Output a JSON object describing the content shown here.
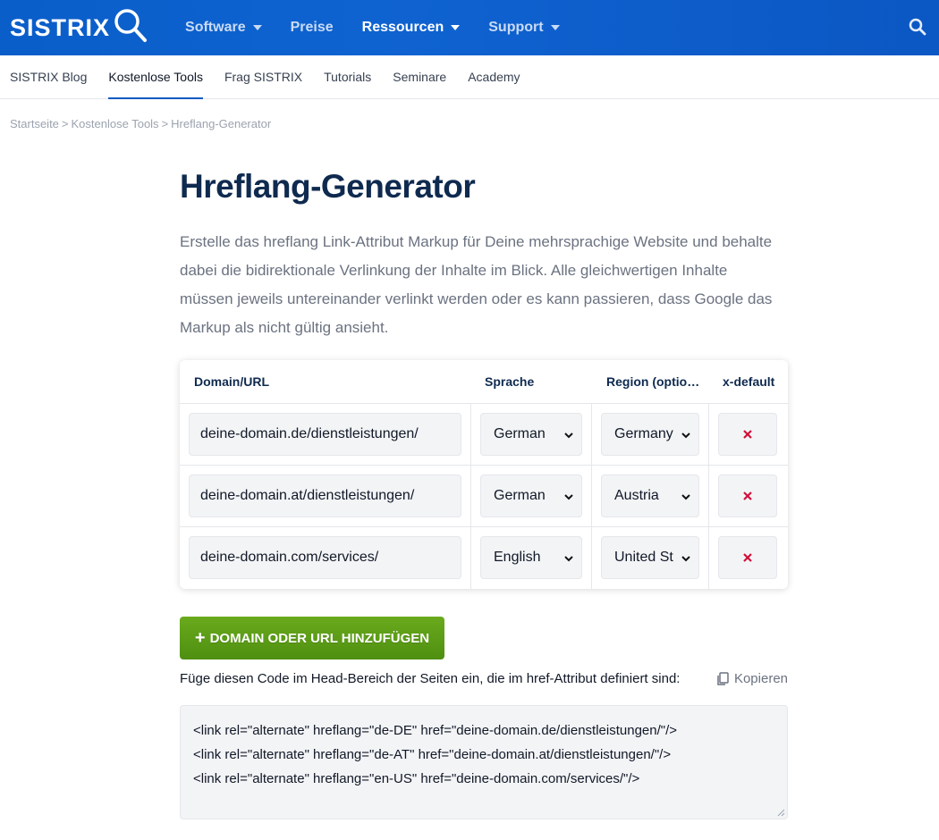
{
  "header": {
    "logo_text": "SISTRIX",
    "nav": [
      {
        "label": "Software",
        "has_caret": true,
        "active": false
      },
      {
        "label": "Preise",
        "has_caret": false,
        "active": false
      },
      {
        "label": "Ressourcen",
        "has_caret": true,
        "active": true
      },
      {
        "label": "Support",
        "has_caret": true,
        "active": false
      }
    ],
    "brand_color": "#0a5ec9"
  },
  "subnav": [
    {
      "label": "SISTRIX Blog",
      "active": false
    },
    {
      "label": "Kostenlose Tools",
      "active": true
    },
    {
      "label": "Frag SISTRIX",
      "active": false
    },
    {
      "label": "Tutorials",
      "active": false
    },
    {
      "label": "Seminare",
      "active": false
    },
    {
      "label": "Academy",
      "active": false
    }
  ],
  "breadcrumb": {
    "items": [
      "Startseite",
      "Kostenlose Tools",
      "Hreflang-Generator"
    ],
    "separator": ">"
  },
  "main": {
    "title": "Hreflang-Generator",
    "intro": "Erstelle das hreflang Link-Attribut Markup für Deine mehrsprachige Website und behalte dabei die bidirektionale Verlinkung der Inhalte im Blick. Alle gleichwertigen Inhalte müssen jeweils untereinander verlinkt werden oder es kann passieren, dass Google das Markup als nicht gültig ansieht."
  },
  "table": {
    "headers": {
      "url": "Domain/URL",
      "language": "Sprache",
      "region": "Region (optio…",
      "xdefault": "x-default"
    },
    "rows": [
      {
        "url": "deine-domain.de/dienstleistungen/",
        "language": "German",
        "region": "Germany"
      },
      {
        "url": "deine-domain.at/dienstleistungen/",
        "language": "German",
        "region": "Austria"
      },
      {
        "url": "deine-domain.com/services/",
        "language": "English",
        "region": "United St"
      }
    ],
    "remove_symbol": "×",
    "remove_color": "#d0103a"
  },
  "actions": {
    "add_label": "DOMAIN ODER URL HINZUFÜGEN",
    "add_color": "#5c9c17",
    "hint": "Füge diesen Code im Head-Bereich der Seiten ein, die im href-Attribut definiert sind:",
    "copy_label": "Kopieren"
  },
  "code": {
    "lines": [
      "<link rel=\"alternate\" hreflang=\"de-DE\" href=\"deine-domain.de/dienstleistungen/\"/>",
      "<link rel=\"alternate\" hreflang=\"de-AT\" href=\"deine-domain.at/dienstleistungen/\"/>",
      "<link rel=\"alternate\" hreflang=\"en-US\" href=\"deine-domain.com/services/\"/>"
    ]
  },
  "icons": {
    "logo": "magnifier-logo-icon",
    "search": "search-icon",
    "dropdown": "chevron-down-icon",
    "remove": "close-icon",
    "copy": "copy-icon",
    "add": "plus-icon"
  }
}
